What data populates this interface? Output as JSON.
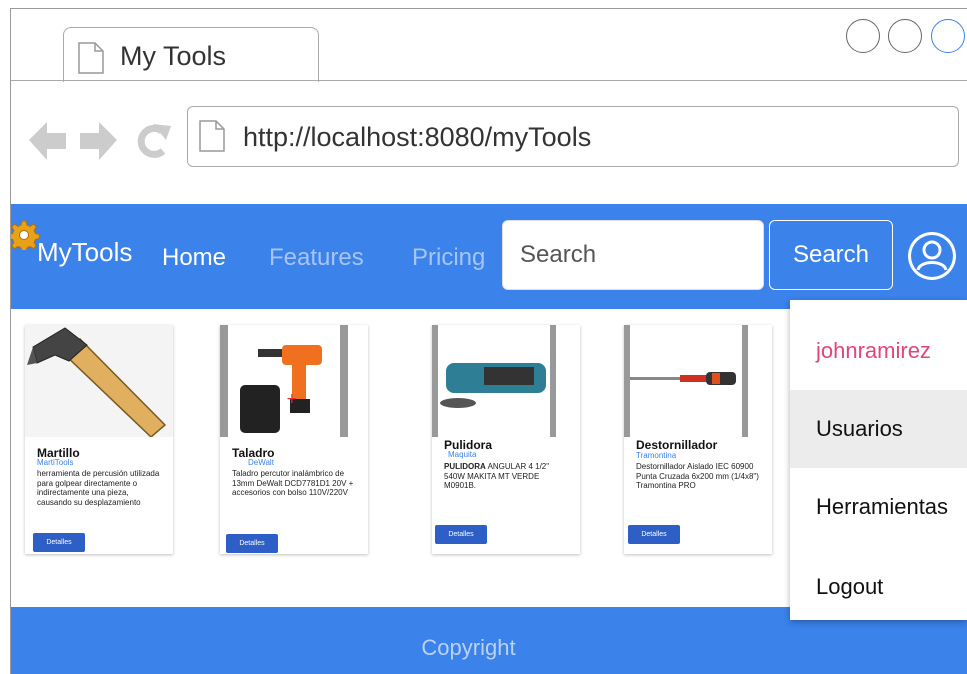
{
  "browser": {
    "tab_title": "My Tools",
    "url": "http://localhost:8080/myTools",
    "icons": [
      "doc-icon",
      "back-arrow-icon",
      "forward-arrow-icon",
      "reload-icon"
    ]
  },
  "navbar": {
    "brand": "MyTools",
    "links": [
      {
        "label": "Home",
        "active": true
      },
      {
        "label": "Features",
        "active": false
      },
      {
        "label": "Pricing",
        "active": false
      }
    ],
    "search_placeholder": "Search",
    "search_button": "Search",
    "color": "#3B82EA"
  },
  "products": [
    {
      "name": "Martillo",
      "brand": "MartiTools",
      "desc_bold": "",
      "desc": "herramienta de percusión utilizada para golpear directamente o indirectamente una pieza, causando su desplazamiento",
      "button": "Detalles"
    },
    {
      "name": "Taladro",
      "brand": "DeWalt",
      "desc_bold": "",
      "desc": "Taladro percutor inalámbrico de 13mm DeWalt DCD7781D1 20V + accesorios con bolso 110V/220V",
      "button": "Detalles"
    },
    {
      "name": "Pulidora",
      "brand": "Maquita",
      "desc_bold": "PULIDORA",
      "desc": " ANGULAR 4 1/2\" 540W MAKITA MT VERDE M0901B.",
      "button": "Detalles"
    },
    {
      "name": "Destornillador",
      "brand": "Tramontina",
      "desc_bold": "",
      "desc": "Destornillador Aislado IEC 60900 Punta Cruzada 6x200 mm (1/4x8\") Tramontina PRO",
      "button": "Detalles"
    }
  ],
  "footer": {
    "copyright": "Copyright"
  },
  "user_menu": {
    "username": "johnramirez",
    "items": [
      "Usuarios",
      "Herramientas",
      "Logout"
    ],
    "username_color": "#E0457B",
    "highlight_color": "#ECECEC"
  }
}
